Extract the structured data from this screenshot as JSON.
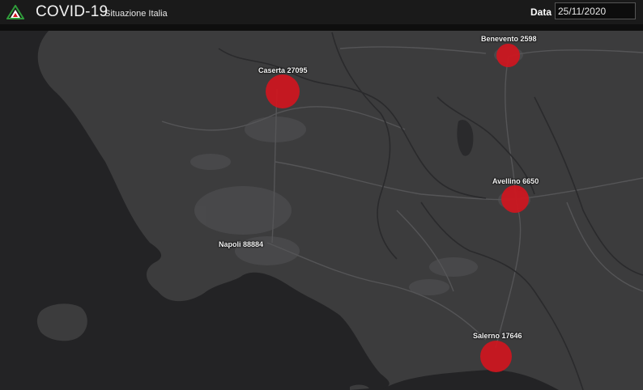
{
  "header": {
    "app_title": "COVID-19",
    "app_subtitle": "Situazione Italia",
    "date_label": "Data",
    "date_value": "25/11/2020",
    "logo_icon": "civil-protection-logo-icon"
  },
  "colors": {
    "marker": "#d0161e",
    "land": "#3c3c3d",
    "sea": "#232325"
  },
  "markers": [
    {
      "id": "caserta",
      "label": "Caserta 27095",
      "name": "Caserta",
      "cases": 27095
    },
    {
      "id": "benevento",
      "label": "Benevento 2598",
      "name": "Benevento",
      "cases": 2598
    },
    {
      "id": "avellino",
      "label": "Avellino 6650",
      "name": "Avellino",
      "cases": 6650
    },
    {
      "id": "napoli",
      "label": "Napoli 88884",
      "name": "Napoli",
      "cases": 88884
    },
    {
      "id": "salerno",
      "label": "Salerno 17646",
      "name": "Salerno",
      "cases": 17646
    }
  ]
}
